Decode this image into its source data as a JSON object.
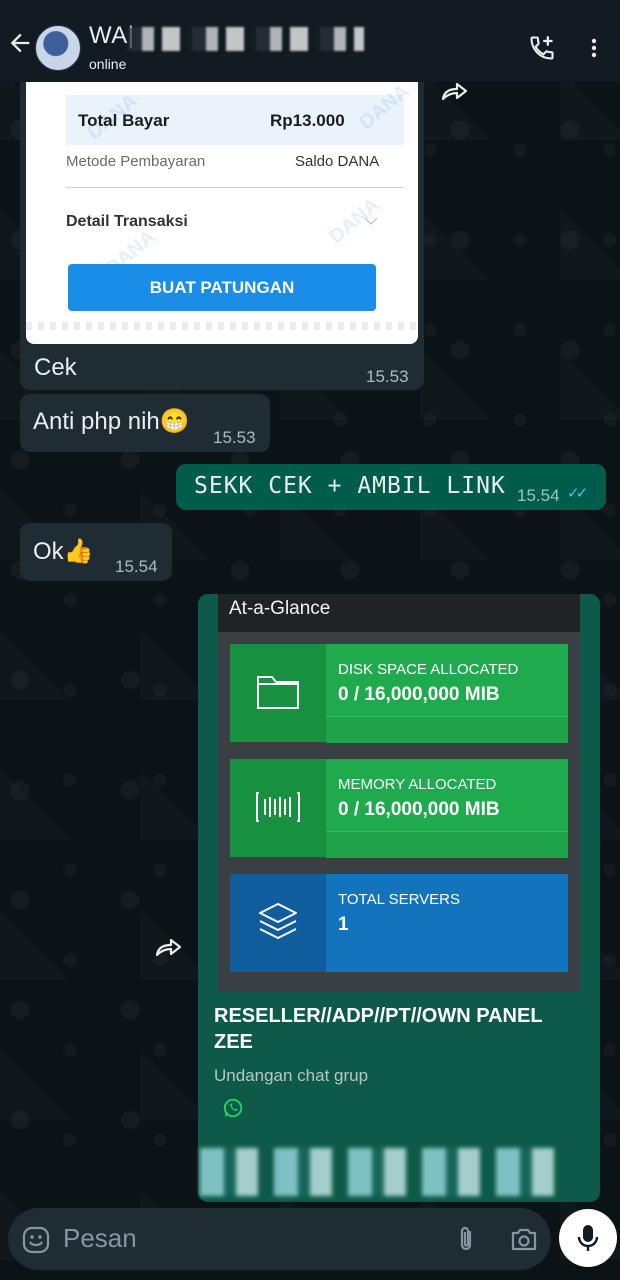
{
  "header": {
    "contact_name": "WA|",
    "status": "online"
  },
  "dana_receipt": {
    "total_label": "Total Bayar",
    "total_value": "Rp13.000",
    "method_label": "Metode Pembayaran",
    "method_value": "Saldo DANA",
    "detail_label": "Detail Transaksi",
    "button_label": "BUAT PATUNGAN",
    "watermark": "DANA"
  },
  "messages": [
    {
      "direction": "incoming",
      "text": "Cek",
      "time": "15.53"
    },
    {
      "direction": "incoming",
      "text": "Anti php nih😁",
      "time": "15.53"
    },
    {
      "direction": "outgoing",
      "text": "SEKK CEK + AMBIL LINK",
      "time": "15.54",
      "read_ticks": "✓✓"
    },
    {
      "direction": "incoming",
      "text": "Ok👍",
      "time": "15.54"
    }
  ],
  "at_a_glance": {
    "title": "At-a-Glance",
    "panels": [
      {
        "label": "DISK SPACE ALLOCATED",
        "value": "0 / 16,000,000 MIB",
        "icon": "folder-icon",
        "color": "#1faa4d",
        "dark": "#17913f"
      },
      {
        "label": "MEMORY ALLOCATED",
        "value": "0 / 16,000,000 MIB",
        "icon": "barcode-icon",
        "color": "#1faa4d",
        "dark": "#17913f"
      },
      {
        "label": "TOTAL SERVERS",
        "value": "1",
        "icon": "layers-icon",
        "color": "#1473bd",
        "dark": "#0f5d9c"
      }
    ]
  },
  "group_invite": {
    "name": "RESELLER//ADP//PT//OWN PANEL ZEE",
    "subtitle": "Undangan chat grup"
  },
  "composer": {
    "placeholder": "Pesan"
  },
  "colors": {
    "incoming_bubble": "#202c33",
    "outgoing_bubble": "#005c4b",
    "read_tick": "#53bdeb",
    "dana_blue": "#1a8de9"
  }
}
